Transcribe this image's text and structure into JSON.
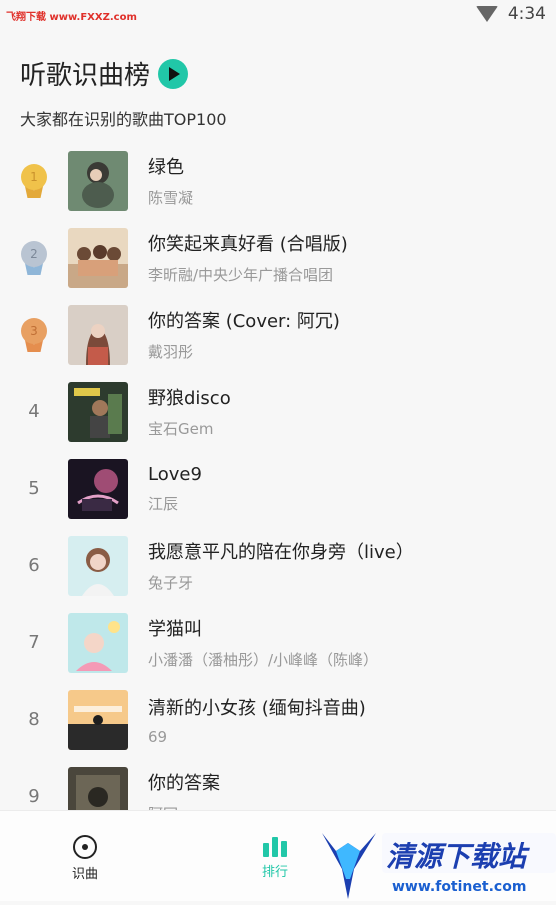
{
  "status": {
    "watermark": "飞翔下载 www.FXXZ.com",
    "time": "4:34"
  },
  "header": {
    "title": "听歌识曲榜",
    "subtitle": "大家都在识别的歌曲TOP100"
  },
  "songs": [
    {
      "rank": "1",
      "title": "绿色",
      "artist": "陈雪凝",
      "medal": "gold"
    },
    {
      "rank": "2",
      "title": "你笑起来真好看 (合唱版)",
      "artist": "李昕融/中央少年广播合唱团",
      "medal": "silver"
    },
    {
      "rank": "3",
      "title": "你的答案 (Cover: 阿冗)",
      "artist": "戴羽彤",
      "medal": "bronze"
    },
    {
      "rank": "4",
      "title": "野狼disco",
      "artist": "宝石Gem"
    },
    {
      "rank": "5",
      "title": "Love9",
      "artist": "江辰"
    },
    {
      "rank": "6",
      "title": "我愿意平凡的陪在你身旁（live）",
      "artist": "兔子牙"
    },
    {
      "rank": "7",
      "title": "学猫叫",
      "artist": "小潘潘（潘柚彤）/小峰峰（陈峰）"
    },
    {
      "rank": "8",
      "title": "清新的小女孩 (缅甸抖音曲)",
      "artist": "69"
    },
    {
      "rank": "9",
      "title": "你的答案",
      "artist": "阿冗"
    }
  ],
  "nav": {
    "identify_label": "识曲",
    "ranking_label": "排行"
  },
  "watermark_bottom": {
    "text": "清源下载站",
    "url": "www.fotinet.com"
  },
  "colors": {
    "accent": "#21c7a8",
    "gold": "#f0c24a",
    "silver": "#b9c4d2",
    "bronze": "#e8a062"
  }
}
